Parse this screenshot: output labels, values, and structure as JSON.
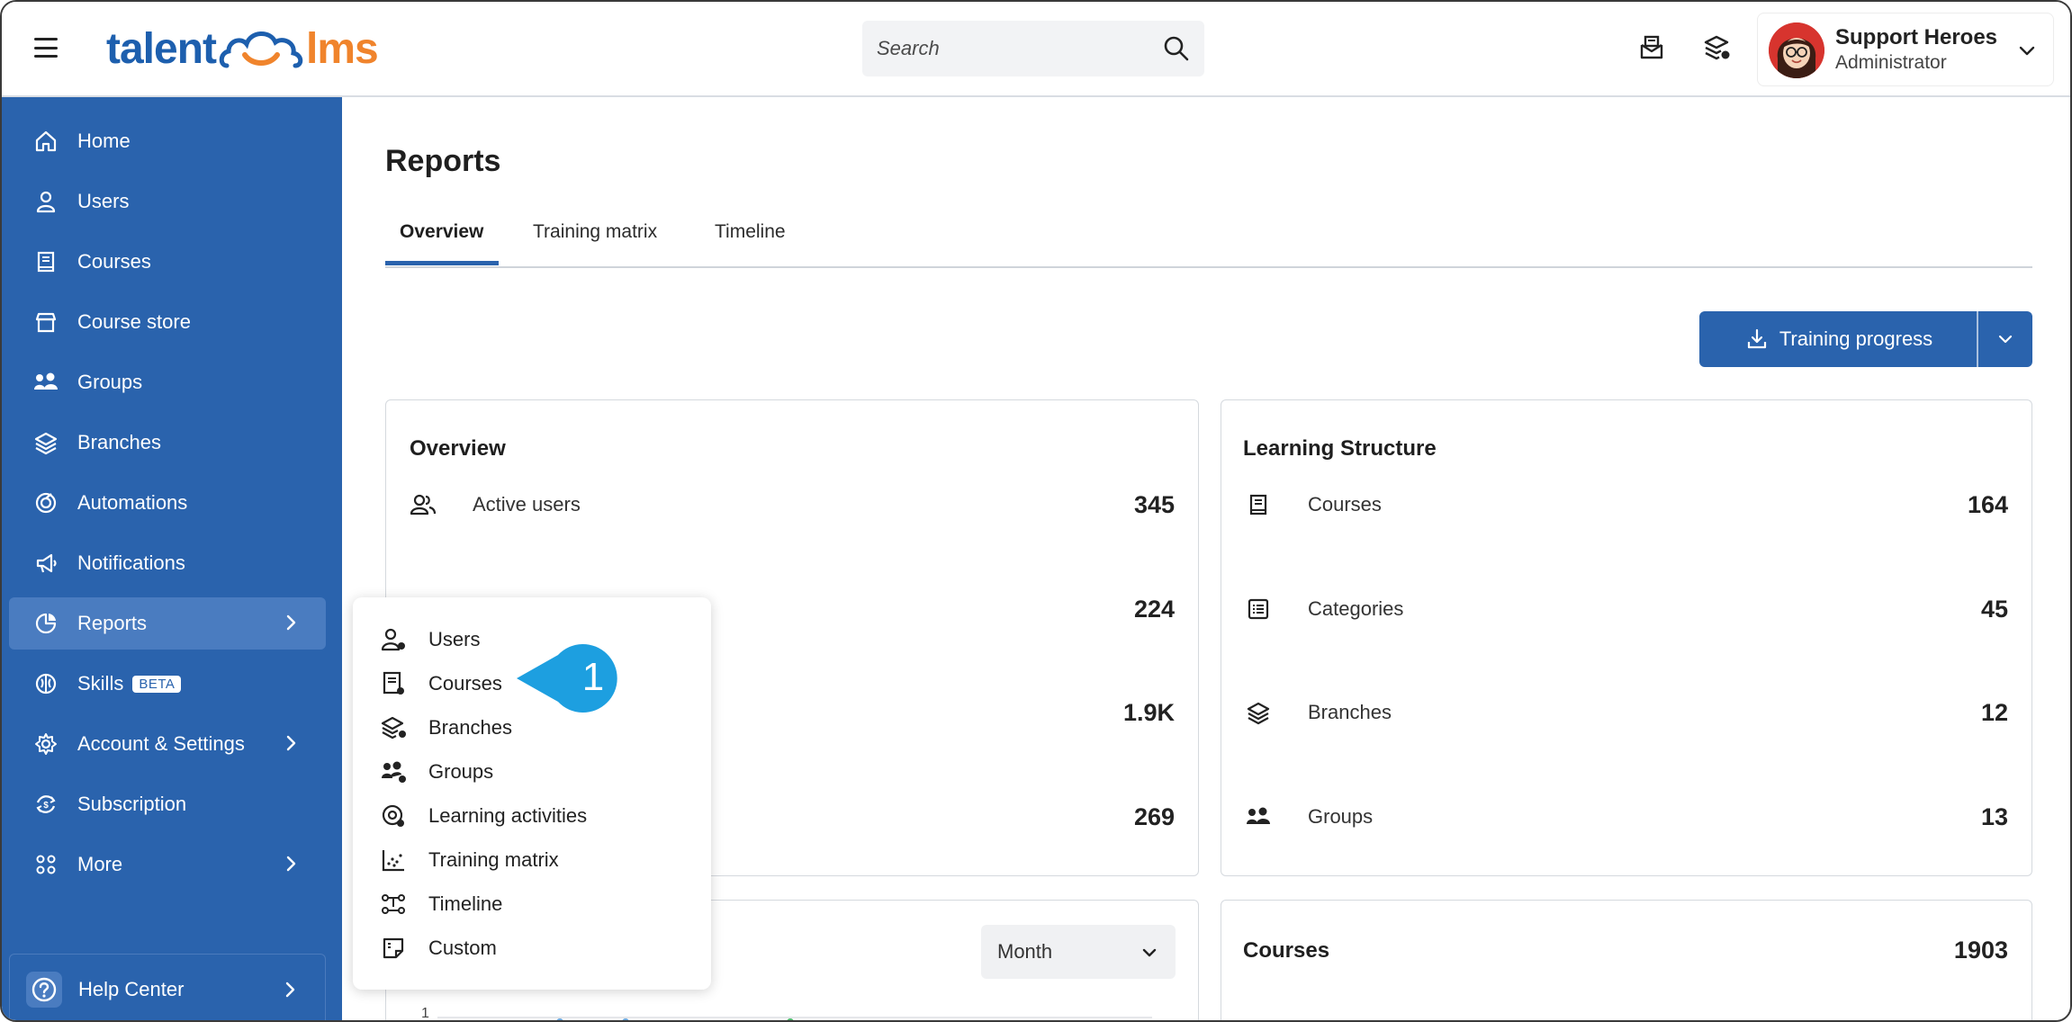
{
  "header": {
    "logo_left": "talent",
    "logo_right": "lms",
    "search_placeholder": "Search",
    "profile_name": "Support Heroes",
    "profile_role": "Administrator"
  },
  "sidebar": {
    "items": [
      {
        "label": "Home",
        "icon": "home-icon"
      },
      {
        "label": "Users",
        "icon": "user-icon"
      },
      {
        "label": "Courses",
        "icon": "book-icon"
      },
      {
        "label": "Course store",
        "icon": "store-icon"
      },
      {
        "label": "Groups",
        "icon": "group-icon"
      },
      {
        "label": "Branches",
        "icon": "layers-icon"
      },
      {
        "label": "Automations",
        "icon": "automation-icon"
      },
      {
        "label": "Notifications",
        "icon": "megaphone-icon"
      },
      {
        "label": "Reports",
        "icon": "pie-chart-icon",
        "active": true
      },
      {
        "label": "Skills",
        "icon": "brain-icon",
        "badge": "BETA"
      },
      {
        "label": "Account & Settings",
        "icon": "gear-icon"
      },
      {
        "label": "Subscription",
        "icon": "subscription-icon"
      },
      {
        "label": "More",
        "icon": "grid-icon"
      }
    ],
    "help_label": "Help Center"
  },
  "main": {
    "title": "Reports",
    "tabs": [
      {
        "label": "Overview",
        "active": true
      },
      {
        "label": "Training matrix"
      },
      {
        "label": "Timeline"
      }
    ],
    "training_progress_label": "Training progress"
  },
  "overview_card": {
    "title": "Overview",
    "rows": [
      {
        "label": "Active users",
        "value": "345"
      },
      {
        "label": "",
        "value": "224"
      },
      {
        "label": "",
        "value": "1.9K"
      },
      {
        "label": "",
        "value": "269"
      }
    ]
  },
  "learning_card": {
    "title": "Learning Structure",
    "rows": [
      {
        "label": "Courses",
        "value": "164"
      },
      {
        "label": "Categories",
        "value": "45"
      },
      {
        "label": "Branches",
        "value": "12"
      },
      {
        "label": "Groups",
        "value": "13"
      }
    ]
  },
  "activity_card": {
    "period": "Month",
    "y_tick": "1"
  },
  "courses_card": {
    "title": "Courses",
    "value": "1903"
  },
  "reports_menu": {
    "items": [
      {
        "label": "Users"
      },
      {
        "label": "Courses"
      },
      {
        "label": "Branches"
      },
      {
        "label": "Groups"
      },
      {
        "label": "Learning activities"
      },
      {
        "label": "Training matrix"
      },
      {
        "label": "Timeline"
      },
      {
        "label": "Custom"
      }
    ]
  },
  "callout": {
    "number": "1",
    "color": "#1d9fe0"
  },
  "colors": {
    "brand_blue": "#2a63ad",
    "brand_orange": "#f0842c"
  }
}
